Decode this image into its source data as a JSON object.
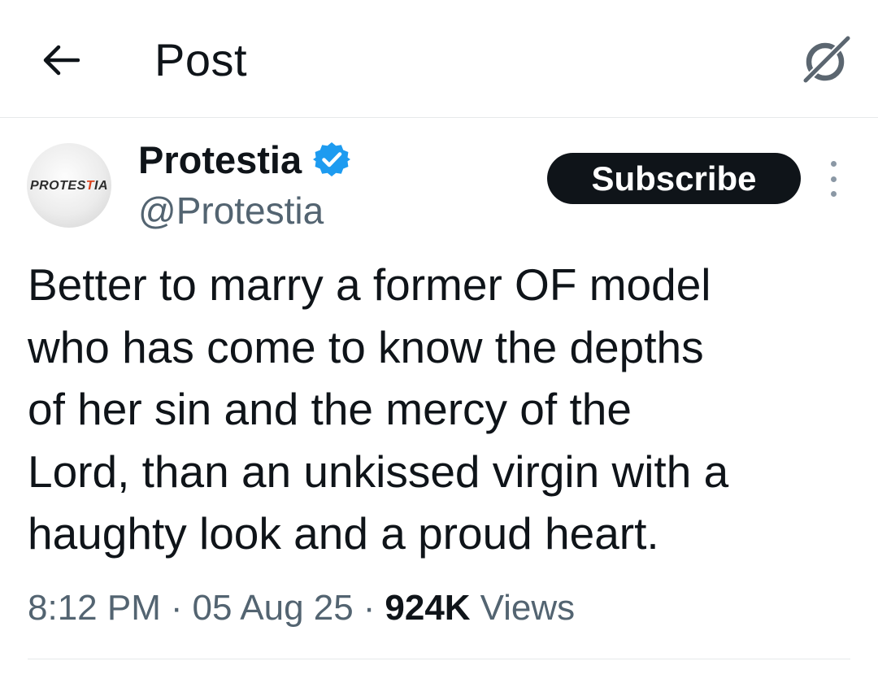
{
  "header": {
    "title": "Post",
    "back_icon": "arrow-left-icon",
    "grok_icon": "grok-icon"
  },
  "post": {
    "author": {
      "name": "Protestia",
      "handle": "@Protestia",
      "verified": true,
      "avatar_text": "PROTESTIA",
      "avatar_text_part1": "PROTES",
      "avatar_text_part2": "T",
      "avatar_text_part3": "IA"
    },
    "subscribe_label": "Subscribe",
    "more_icon": "more-vertical-icon",
    "text_lines": [
      "Better to marry a former OF model",
      "who has come to know the depths",
      "of her sin and the mercy of the",
      "Lord, than an unkissed virgin with a",
      "haughty look and a proud heart."
    ],
    "time": "8:12 PM",
    "date": "05 Aug 25",
    "separator": "·",
    "views_count": "924K",
    "views_label": "Views"
  },
  "colors": {
    "text": "#0f1419",
    "secondary": "#536471",
    "verified_blue": "#1d9bf0",
    "button_bg": "#0f1419",
    "divider": "#e6e9ea"
  }
}
